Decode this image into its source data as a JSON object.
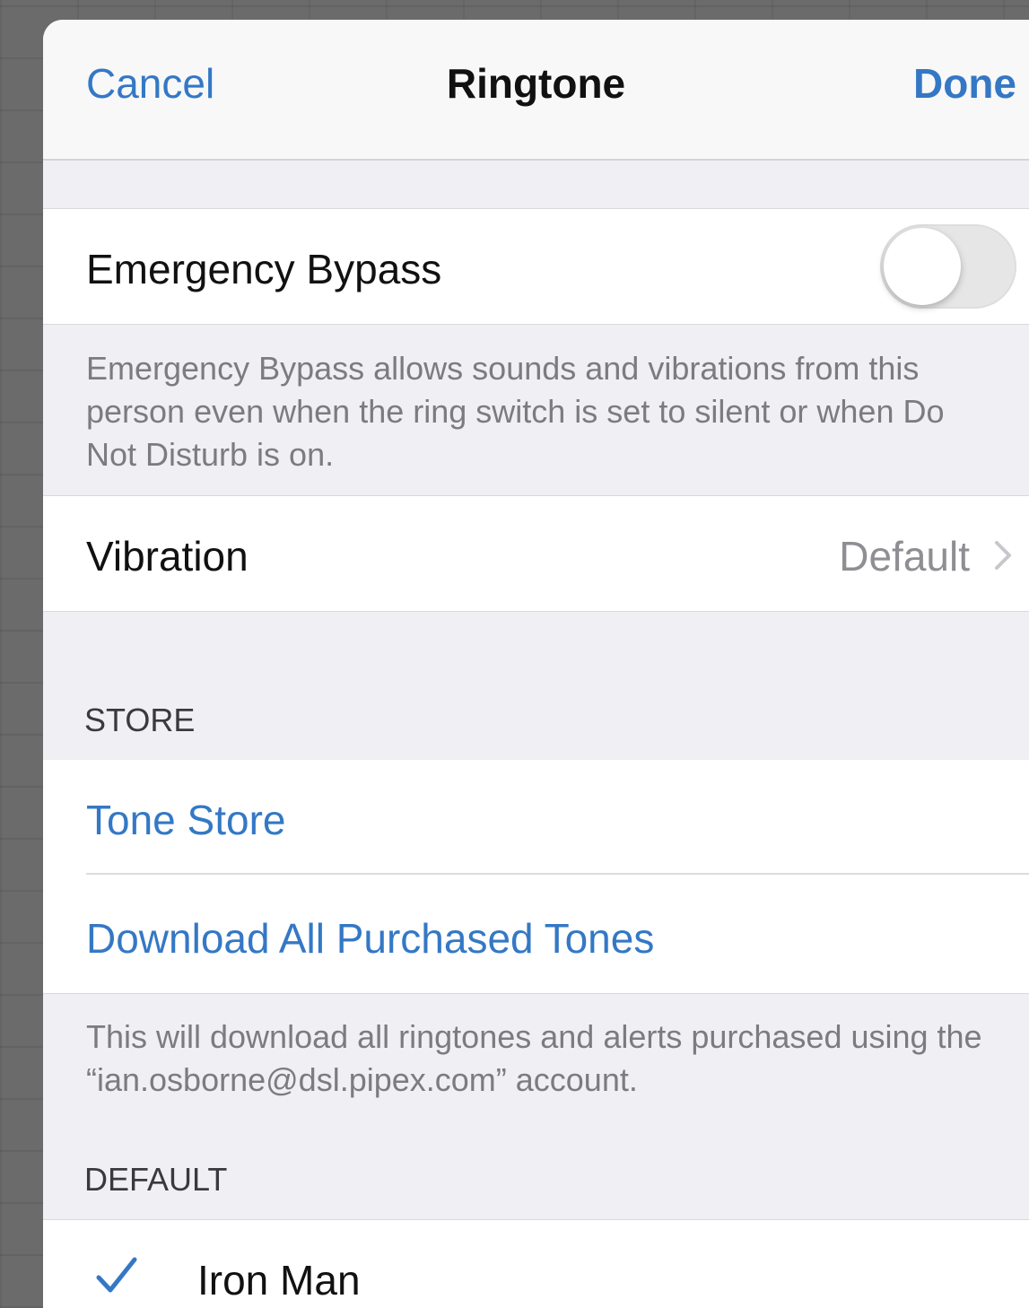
{
  "navbar": {
    "cancel_label": "Cancel",
    "title": "Ringtone",
    "done_label": "Done"
  },
  "emergency_bypass": {
    "label": "Emergency Bypass",
    "enabled": false,
    "footer": "Emergency Bypass allows sounds and vibrations from this person even when the ring switch is set to silent or when Do Not Disturb is on."
  },
  "vibration": {
    "label": "Vibration",
    "value": "Default"
  },
  "store": {
    "header": "STORE",
    "tone_store_label": "Tone Store",
    "download_label": "Download All Purchased Tones",
    "footer": "This will download all ringtones and alerts purchased using the “ian.osborne@dsl.pipex.com” account."
  },
  "default_section": {
    "header": "DEFAULT",
    "items": [
      {
        "label": "Iron Man",
        "selected": true
      }
    ]
  },
  "colors": {
    "accent": "#3478c5",
    "secondary_text": "#8e8e93",
    "group_background": "#efeff4"
  },
  "icons": {
    "chevron": "chevron-right-icon",
    "check": "checkmark-icon"
  }
}
